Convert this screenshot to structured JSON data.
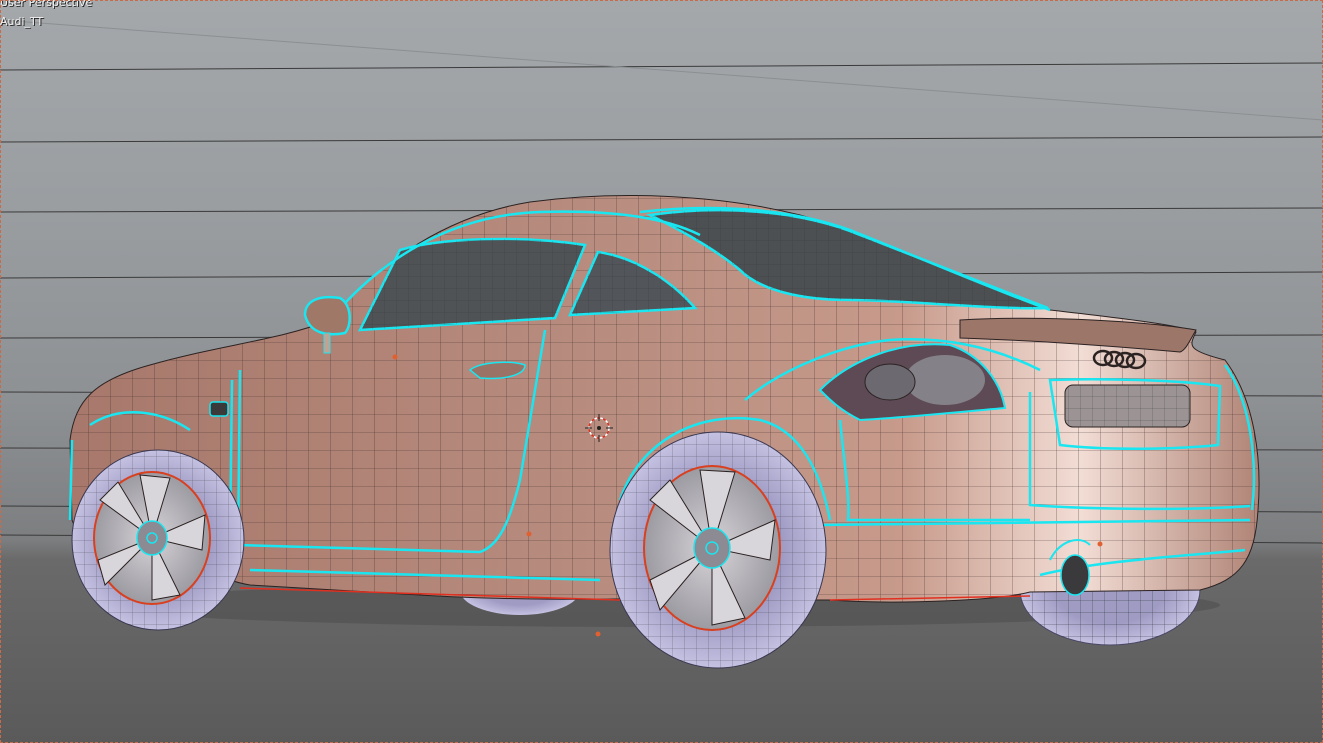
{
  "viewport": {
    "view_name": "User Perspective",
    "object_name": "Audi_TT"
  },
  "colors": {
    "body_paint": "#b98a7c",
    "wire": "#2b2222",
    "selected_edge": "#19e6f0",
    "tire": "#a8a4c8",
    "window": "#4e5154",
    "origin": "#e06030"
  },
  "icons": {
    "cursor": "3d-cursor-icon",
    "origin": "origin-dot-icon"
  }
}
